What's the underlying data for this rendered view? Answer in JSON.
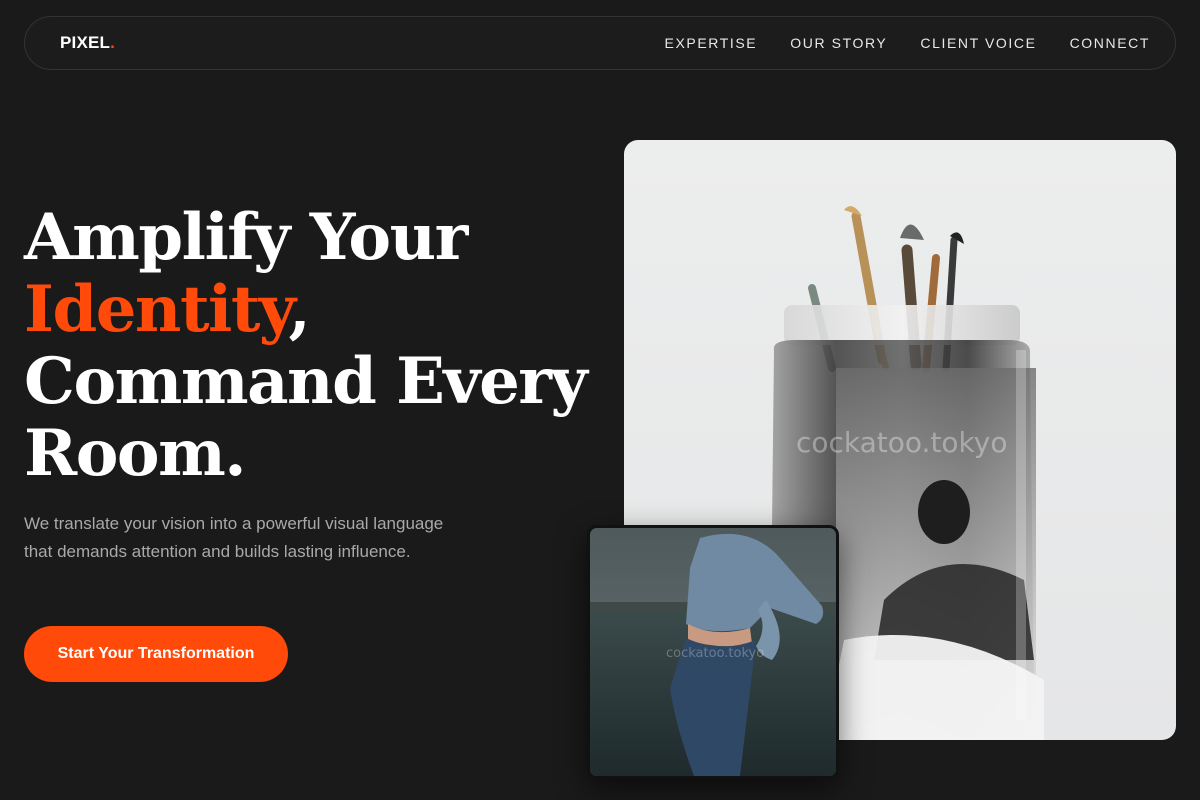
{
  "nav": {
    "logo_text": "PIXEL",
    "logo_dot": ".",
    "links": [
      "EXPERTISE",
      "OUR STORY",
      "CLIENT VOICE",
      "CONNECT"
    ]
  },
  "hero": {
    "title_line1": "Amplify Your",
    "title_accent": "Identity",
    "title_comma": ",",
    "title_line3": "Command Every",
    "title_line4": "Room.",
    "subtitle": "We translate your vision into a powerful visual language that demands attention and builds lasting influence.",
    "cta_label": "Start Your Transformation"
  },
  "images": {
    "main_watermark": "cockatoo.tokyo",
    "secondary_watermark": "cockatoo.tokyo"
  },
  "colors": {
    "background": "#1a1a1a",
    "accent": "#ff4a0a",
    "nav_border": "#333333",
    "subtitle_text": "#a9a9a9"
  },
  "icons": {
    "main_image": "paint-brushes-in-glass-jar-photo",
    "secondary_image": "denim-jacket-fashion-photo"
  }
}
